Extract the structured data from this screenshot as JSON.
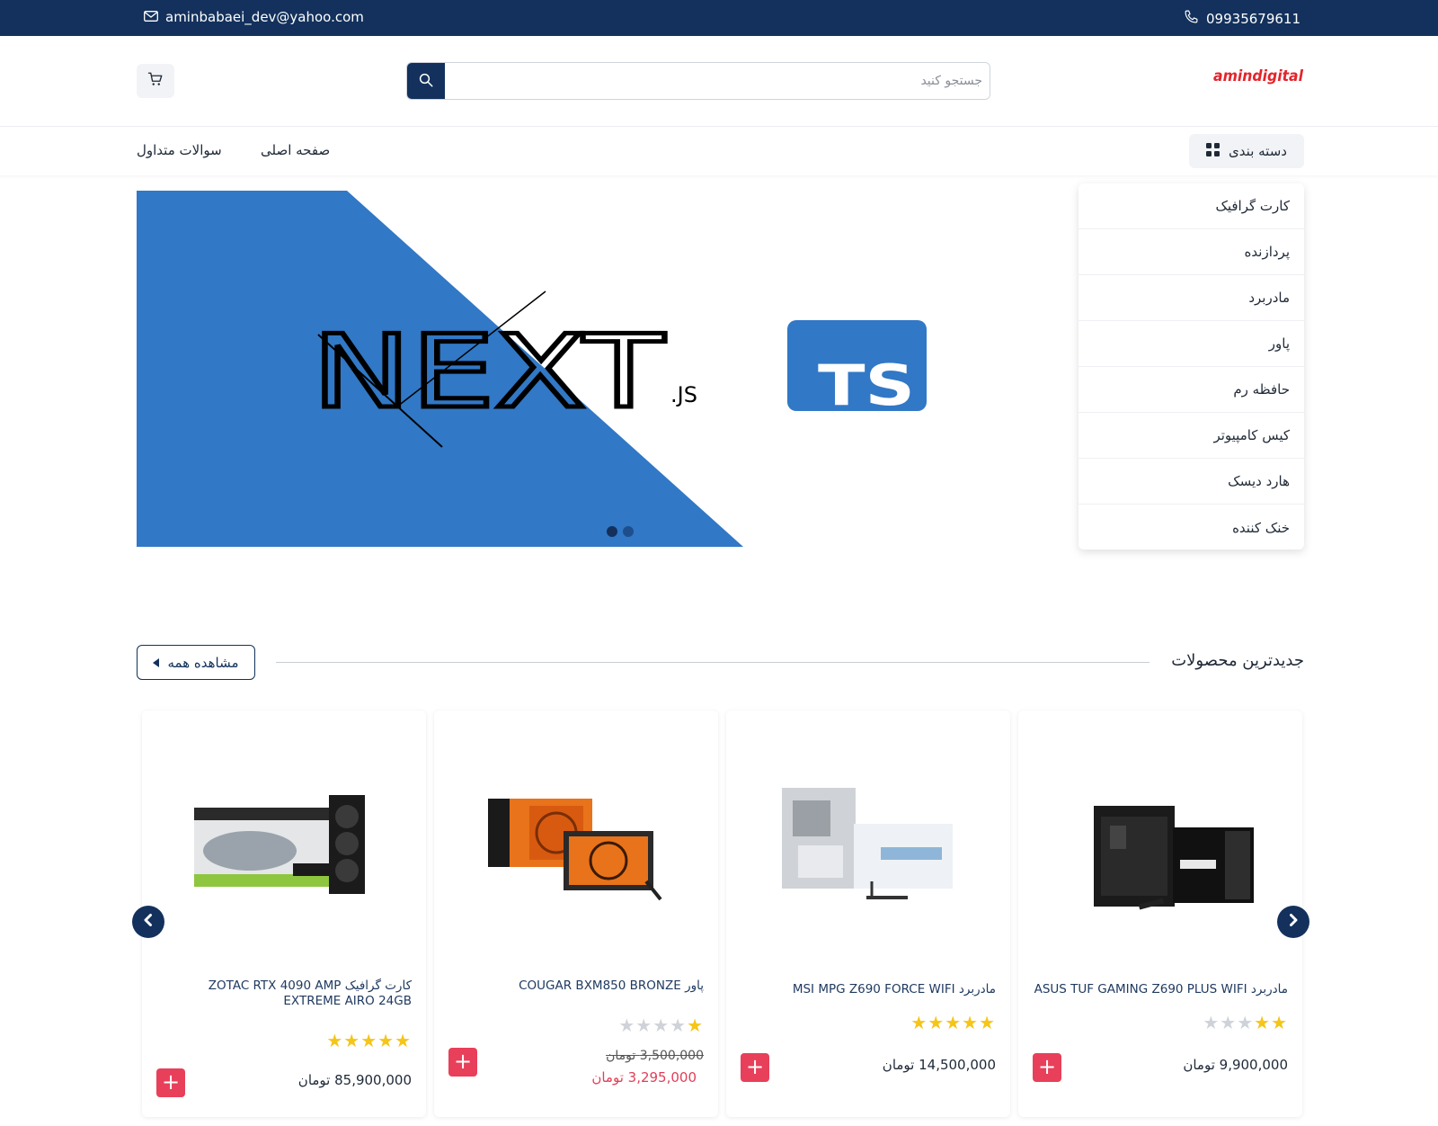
{
  "topbar": {
    "email": "aminbabaei_dev@yahoo.com",
    "phone": "09935679611"
  },
  "header": {
    "logo_text": "amindigital",
    "search_placeholder": "جستجو کنید"
  },
  "nav": {
    "category_label": "دسته بندی",
    "links": [
      "صفحه اصلی",
      "سوالات متداول"
    ]
  },
  "categories": [
    "کارت گرافیک",
    "پردازنده",
    "مادربرد",
    "پاور",
    "حافظه رم",
    "کیس کامپیوتر",
    "هارد دیسک",
    "خنک کننده"
  ],
  "slider": {
    "brand_text": "NEXT",
    "brand_suffix": ".JS",
    "badge_text": "TS",
    "slide_count": 2,
    "active_slide": 1
  },
  "section": {
    "title": "جدیدترین محصولات",
    "view_all": "مشاهده همه"
  },
  "products": [
    {
      "title": "مادربرد ASUS TUF GAMING Z690 PLUS WIFI",
      "rating": 2,
      "price": "9,900,000 تومان"
    },
    {
      "title": "مادربرد MSI MPG Z690 FORCE WIFI",
      "rating": 5,
      "price": "14,500,000 تومان"
    },
    {
      "title": "پاور COUGAR BXM850 BRONZE",
      "rating": 1,
      "old_price": "3,500,000 تومان",
      "price": "3,295,000 تومان"
    },
    {
      "title": "کارت گرافیک ZOTAC RTX 4090 AMP EXTREME AIRO 24GB",
      "rating": 5,
      "price": "85,900,000 تومان"
    }
  ],
  "colors": {
    "primary": "#13315c",
    "accent": "#e8405a",
    "slide_blue": "#3178c6",
    "star": "#f5c518"
  }
}
